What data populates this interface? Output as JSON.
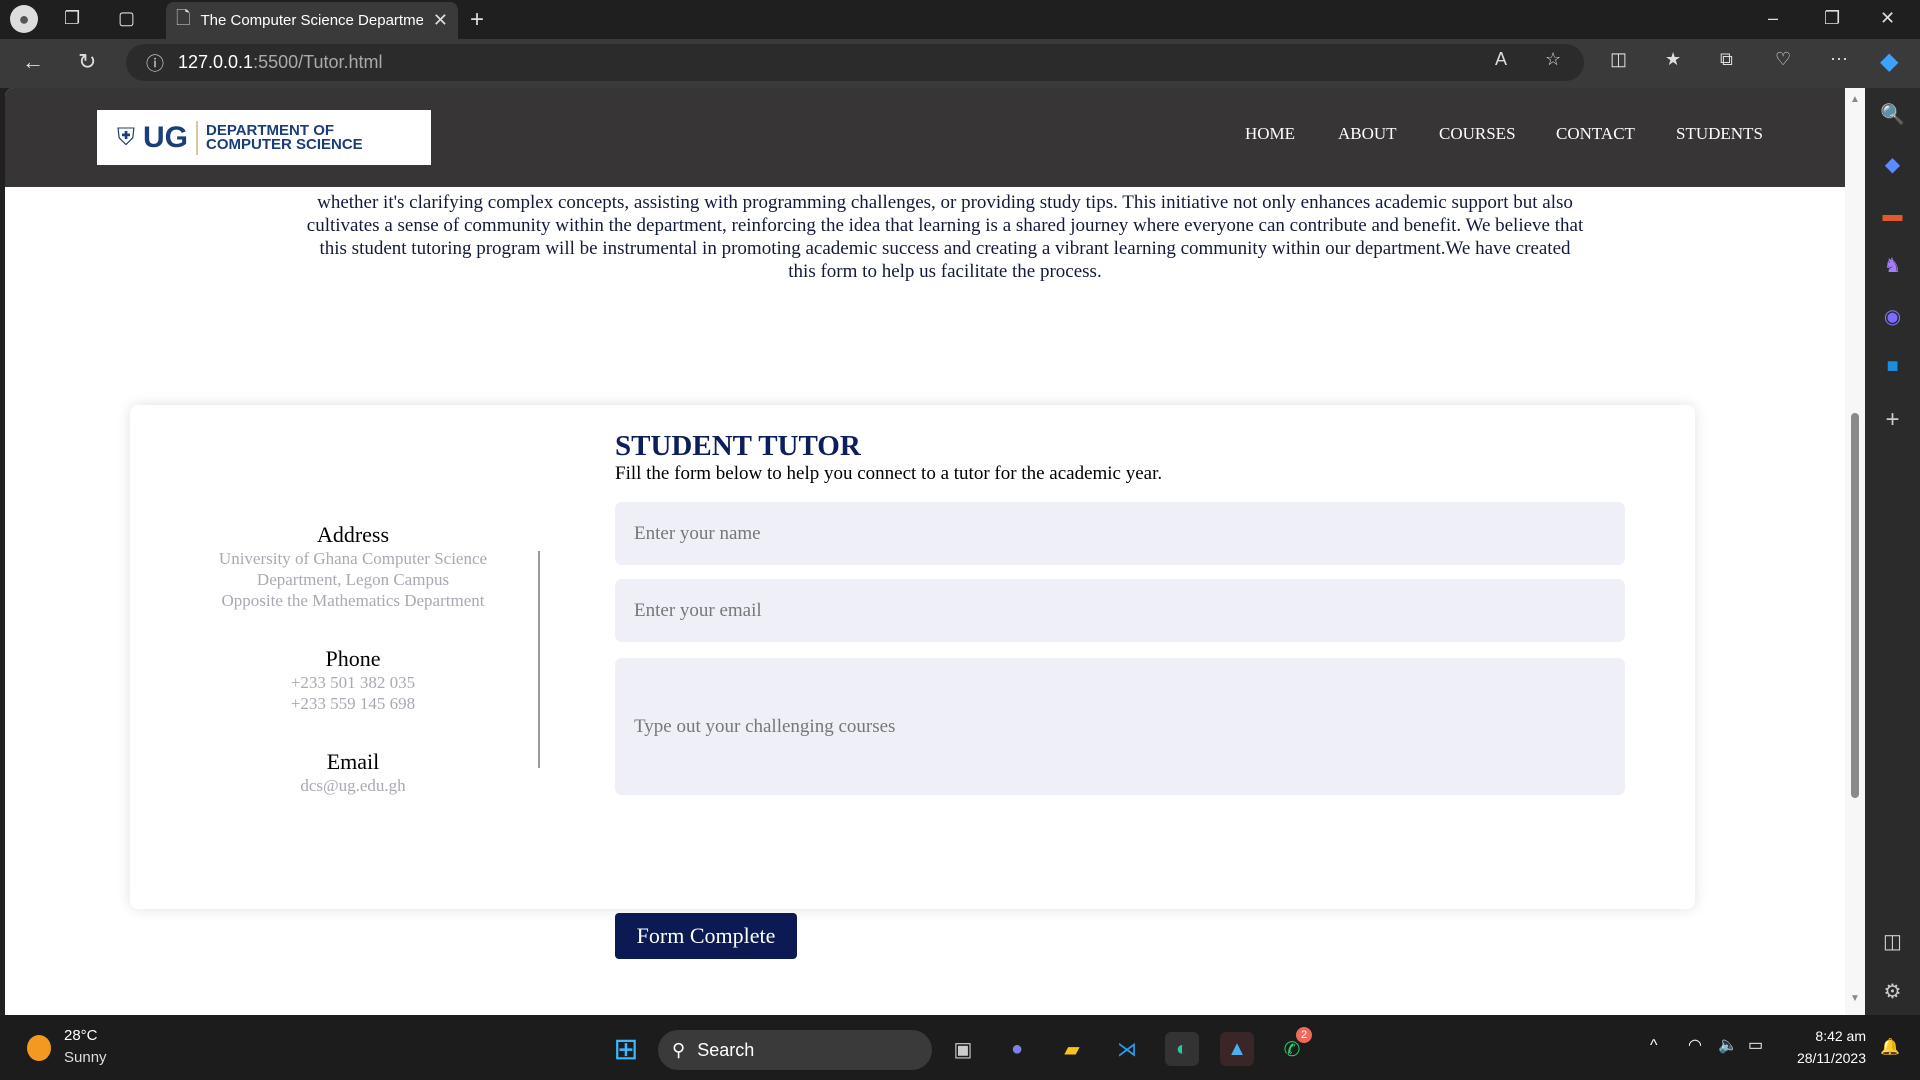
{
  "browser": {
    "tab_title": "The Computer Science Departme",
    "url_host": "127.0.0.1",
    "url_rest": ":5500/Tutor.html"
  },
  "site": {
    "logo_ug": "UG",
    "logo_line1": "DEPARTMENT OF",
    "logo_line2": "COMPUTER SCIENCE",
    "nav": [
      "HOME",
      "ABOUT",
      "COURSES",
      "CONTACT",
      "STUDENTS"
    ]
  },
  "intro": "whether it's clarifying complex concepts, assisting with programming challenges, or providing study tips. This initiative not only enhances academic support but also cultivates a sense of community within the department, reinforcing the idea that learning is a shared journey where everyone can contribute and benefit. We believe that this student tutoring program will be instrumental in promoting academic success and creating a vibrant learning community within our department.We have created this form to help us facilitate the process.",
  "contact": {
    "address_label": "Address",
    "address_lines": [
      "University of Ghana Computer Science",
      "Department, Legon Campus",
      "Opposite the Mathematics Department"
    ],
    "phone_label": "Phone",
    "phones": [
      "+233 501 382 035",
      "+233 559 145 698"
    ],
    "email_label": "Email",
    "email": "dcs@ug.edu.gh"
  },
  "form": {
    "title": "STUDENT TUTOR",
    "subtitle": "Fill the form below to help you connect to a tutor for the academic year.",
    "name_placeholder": "Enter your name",
    "email_placeholder": "Enter your email",
    "courses_placeholder": "Type out your challenging courses",
    "submit": "Form Complete"
  },
  "taskbar": {
    "temp": "28°C",
    "weather": "Sunny",
    "search": "Search",
    "time": "8:42 am",
    "date": "28/11/2023",
    "whatsapp_badge": "2"
  },
  "colors": {
    "navy": "#0b1a52",
    "nav_bg": "#373535",
    "input_bg": "#eeeff7"
  }
}
